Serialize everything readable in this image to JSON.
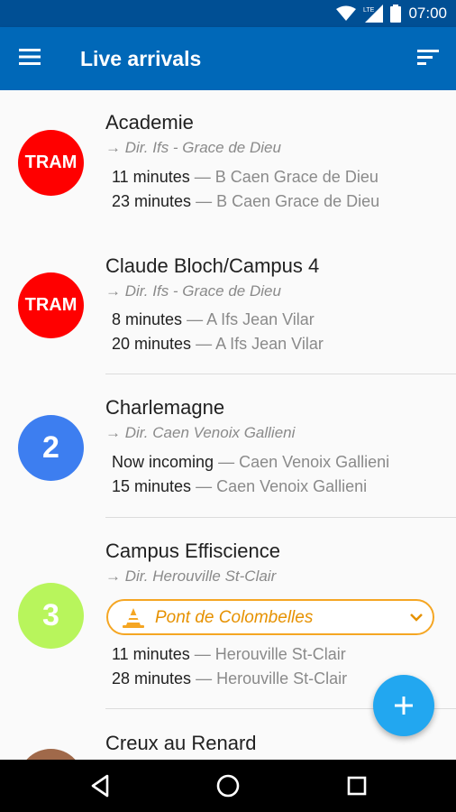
{
  "status_bar": {
    "time": "07:00",
    "network_label": "LTE"
  },
  "app_bar": {
    "title": "Live arrivals",
    "menu_icon": "hamburger-menu-icon",
    "sort_icon": "sort-icon"
  },
  "colors": {
    "primary": "#0068b8",
    "status_bar": "#004f94",
    "tram": "#ff0000",
    "line_2": "#3d7ef0",
    "line_3": "#b8f55c",
    "line_brown": "#a0694a",
    "fab": "#22a7f0",
    "alert": "#f5a623"
  },
  "stops": [
    {
      "line": "TRAM",
      "name": "Academie",
      "direction": "→ Dir. Ifs - Grace de Dieu",
      "arrivals": [
        {
          "time": "11 minutes",
          "dest": "— B Caen Grace de Dieu"
        },
        {
          "time": "23 minutes",
          "dest": "— B Caen Grace de Dieu"
        }
      ]
    },
    {
      "line": "TRAM",
      "name": "Claude Bloch/Campus 4",
      "direction": "→ Dir. Ifs - Grace de Dieu",
      "arrivals": [
        {
          "time": "8 minutes",
          "dest": "— A Ifs Jean Vilar"
        },
        {
          "time": "20 minutes",
          "dest": "— A Ifs Jean Vilar"
        }
      ]
    },
    {
      "line": "2",
      "name": "Charlemagne",
      "direction": "→ Dir. Caen Venoix Gallieni",
      "arrivals": [
        {
          "time": "Now incoming",
          "dest": "— Caen Venoix Gallieni"
        },
        {
          "time": "15 minutes",
          "dest": "— Caen Venoix Gallieni"
        }
      ]
    },
    {
      "line": "3",
      "name": "Campus Effiscience",
      "direction": "→ Dir. Herouville St-Clair",
      "alert": {
        "text": "Pont de Colombelles",
        "icon": "traffic-cone-icon"
      },
      "arrivals": [
        {
          "time": "11 minutes",
          "dest": "— Herouville St-Clair"
        },
        {
          "time": "28 minutes",
          "dest": "— Herouville St-Clair"
        }
      ]
    },
    {
      "line": "",
      "name": "Creux au Renard"
    }
  ],
  "fab": {
    "label": "+"
  },
  "nav": {
    "back_icon": "back-icon",
    "home_icon": "home-icon",
    "recents_icon": "recents-icon"
  }
}
